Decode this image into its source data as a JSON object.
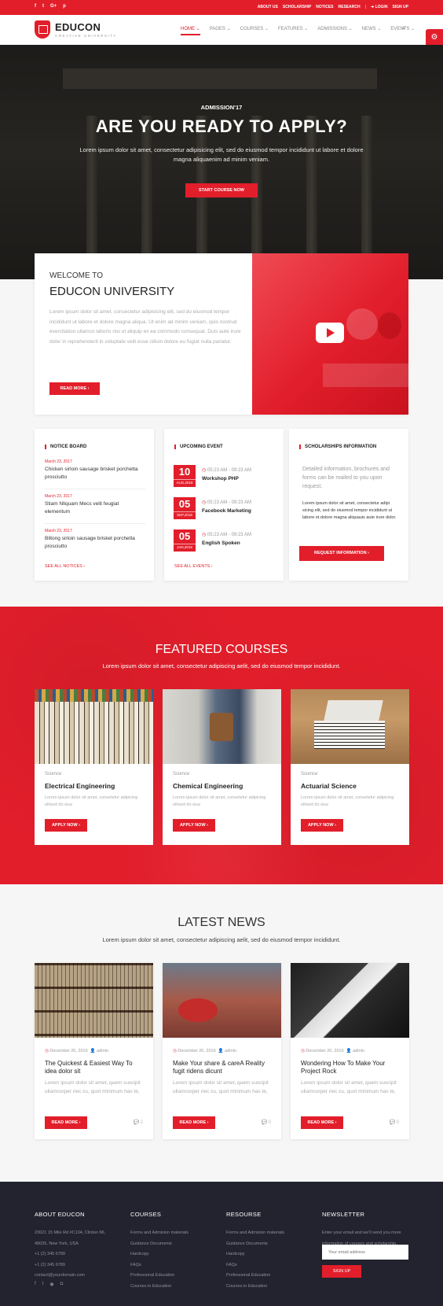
{
  "topbar": {
    "social": [
      "f",
      "t",
      "G+",
      "p"
    ],
    "links": [
      "ABOUT US",
      "SCHOLARSHIP",
      "NOTICES",
      "RESEARCH",
      "LOGIN",
      "SIGN UP"
    ]
  },
  "header": {
    "logo_title": "EDUCON",
    "logo_sub": "CREATIVE UNIVERSITY",
    "nav": [
      "HOME",
      "PAGES",
      "COURSES",
      "FEATURES",
      "ADMISSIONS",
      "NEWS",
      "EVENTS"
    ]
  },
  "hero": {
    "kicker": "ADMISSION'17",
    "title": "ARE YOU READY TO APPLY?",
    "text": "Lorem ipsum dolor sit amet, consectetur adipisicing elit, sed do eiusmod tempor incididunt ut labore et dolore magna aliquaenim ad minim veniam.",
    "button": "START COURSE NOW"
  },
  "welcome": {
    "label": "WELCOME TO",
    "title": "EDUCON UNIVERSITY",
    "body": "Lorem ipsum dolor sit amet, consectetur adipisicing elit, sed do eiusmod tempor incididunt ut labore et dolore magna aliqua. Ut enim ad minim veniam, quis nostrud exercitation ullamco laboris nisi ut aliquip ex ea commodo consequat. Duis aute irure dolor in reprehenderit in voluptate velit esse cillum dolore eu fugiat nulla pariatur.",
    "button": "READ MORE"
  },
  "notice_board": {
    "title": "NOTICE BOARD",
    "items": [
      {
        "date": "March 23, 2017",
        "text": "Chicken sirloin sausage brisket porchetta prosciutto"
      },
      {
        "date": "March 23, 2017",
        "text": "Stiam Nliquam Mecs velit feugiat elementum"
      },
      {
        "date": "March 23, 2017",
        "text": "Biltong sirloin sausage brisket porchetta prosciutto"
      }
    ],
    "see_all": "SEE ALL NOTICES"
  },
  "upcoming": {
    "title": "UPCOMING EVENT",
    "items": [
      {
        "day": "10",
        "month": "AUG,2018",
        "time": "05:23 AM - 09:23 AM",
        "name": "Workshop PHP"
      },
      {
        "day": "05",
        "month": "SEP,2018",
        "time": "05:23 AM - 09:23 AM",
        "name": "Facebook Marketing"
      },
      {
        "day": "05",
        "month": "JAN,2019",
        "time": "05:23 AM - 09:23 AM",
        "name": "English Spoken"
      }
    ],
    "see_all": "SEE ALL EVENTS"
  },
  "scholarship": {
    "title": "SCHOLARSHIPS INFORMATION",
    "lead": "Detailed information, brochures and forms can be mailed to you upon request.",
    "body": "Lorem ipsum dolor sit amet, consectetur adipi sicing elit, sed do eiusmod tempor incididunt ut labore et.dolore magna aliquauis aute irure dolor.",
    "button": "REQUEST INFORMATION"
  },
  "featured": {
    "title": "FEATURED COURSES",
    "subtitle": "Lorem ipsum dolor sit amet, consectetur adipiscing aelit, sed do eiusmod tempor incididunt.",
    "courses": [
      {
        "category": "Science",
        "title": "Electrical Engineering",
        "desc": "Lorem ipsum dolor sit amet, consetetur adipicing elitsed do eius",
        "button": "APPLY NOW"
      },
      {
        "category": "Science",
        "title": "Chemical Engineering",
        "desc": "Lorem ipsum dolor sit amet, consetetur adipicing elitsed do eius",
        "button": "APPLY NOW"
      },
      {
        "category": "Science",
        "title": "Actuarial Science",
        "desc": "Lorem ipsum dolor sit amet, consetetur adipicing elitsed do eius",
        "button": "APPLY NOW"
      }
    ]
  },
  "latest": {
    "title": "LATEST NEWS",
    "subtitle": "Lorem ipsum dolor sit amet, consectetur adipiscing aelit, sed do eiusmod tempor incididunt.",
    "items": [
      {
        "date": "December 26, 2016",
        "author": "admin",
        "title": "The Quickest & Easiest Way To idea dolor sit",
        "desc": "Lorem ipsum dolor sit amet, quem suscipit ullamcorper nec cu, quot minimum has te,",
        "button": "READ MORE",
        "comments": "2"
      },
      {
        "date": "December 26, 2016",
        "author": "admin",
        "title": "Make Your share & careA Reality fugit ridens dicunt",
        "desc": "Lorem ipsum dolor sit amet, quem suscipit ullamcorper nec cu, quot minimum has te,",
        "button": "READ MORE",
        "comments": "0"
      },
      {
        "date": "December 26, 2016",
        "author": "admin",
        "title": "Wondering How To Make Your Project Rock",
        "desc": "Lorem ipsum dolor sit amet, quem suscipit ullamcorper nec cu, quot minimum has te,",
        "button": "READ MORE",
        "comments": "0"
      }
    ]
  },
  "footer": {
    "about": {
      "title": "ABOUT EDUCON",
      "lines": [
        "23621 15 Mile Rd #C104, Clinton MI,",
        "48035, New York, USA",
        "+1 (2) 345 6789",
        "+1 (2) 345 6789",
        "contact@yourdomain.com"
      ]
    },
    "courses": {
      "title": "COURSES",
      "lines": [
        "Forms and Admision materials",
        "Guidance Documents",
        "Hardcopy",
        "FAQs",
        "Professional Education",
        "Courses in Education"
      ]
    },
    "resourse": {
      "title": "RESOURSE",
      "lines": [
        "Forms and Admision materials",
        "Guidance Documents",
        "Hardcopy",
        "FAQs",
        "Professional Education",
        "Courses in Education"
      ]
    },
    "newsletter": {
      "title": "NEWSLETTER",
      "text": "Enter your email and we'll send you more information of courses and scholarship.",
      "placeholder": "Your email address",
      "button": "SIGN UP"
    },
    "social": [
      "f",
      "t",
      "rss",
      "ig"
    ]
  }
}
